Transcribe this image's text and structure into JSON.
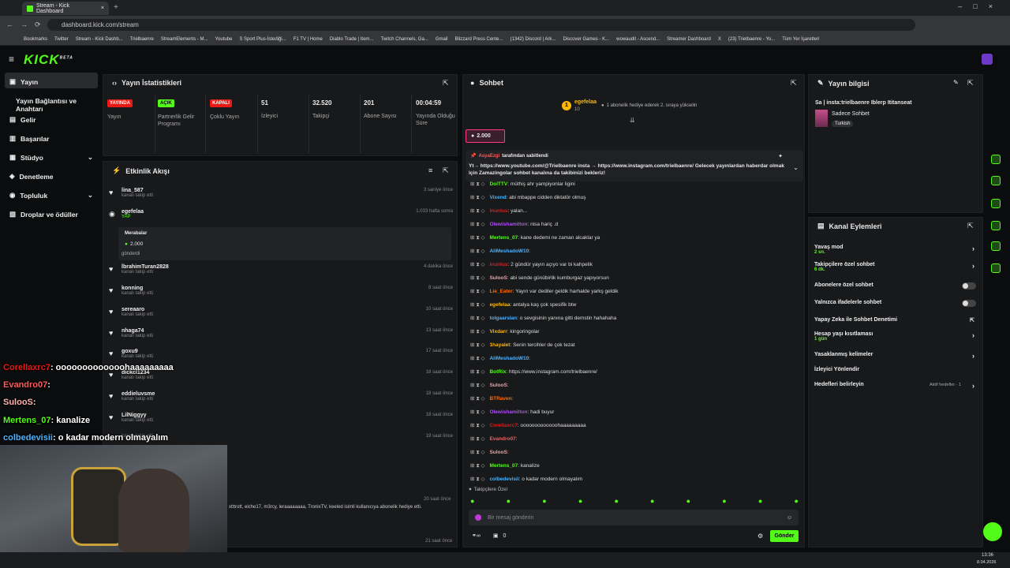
{
  "browser": {
    "tab_title": "Stream - Kick Dashboard",
    "url": "dashboard.kick.com/stream",
    "bookmarks": [
      "Bookmarks",
      "Twitter",
      "Stream - Kick Dashb...",
      "Trielbaenre",
      "StreamElements - M...",
      "Youtube",
      "S Sport Plus-İstediği...",
      "F1 TV | Home",
      "Diablo Trade | Item...",
      "Twitch Channels, Ga...",
      "Gmail",
      "Blizzard Press Cente...",
      "(1342) Discord | Ark...",
      "Discover Games - K...",
      "wowaudit - Ascend...",
      "Streamer Dashboard",
      "X",
      "(23) Trielbaenre - Yo...",
      "Tüm Yer İşaretleri"
    ]
  },
  "logo": "KICK",
  "logo_tag": "BETA",
  "sidebar": {
    "items": [
      {
        "label": "Yayın"
      },
      {
        "label": "Yayın Bağlantısı ve Anahtarı"
      },
      {
        "label": "Gelir"
      },
      {
        "label": "Başarılar"
      },
      {
        "label": "Stüdyo"
      },
      {
        "label": "Denetleme"
      },
      {
        "label": "Topluluk"
      },
      {
        "label": "Droplar ve ödüller"
      }
    ]
  },
  "stats": {
    "title": "Yayın İstatistikleri",
    "items": [
      {
        "badge": "YAYINDA",
        "label": "Yayın",
        "color": "#e91916"
      },
      {
        "badge": "AÇIK",
        "label": "Partnerlik Gelir Programı",
        "color": "#53fc18"
      },
      {
        "badge": "KAPALI",
        "label": "Çoklu Yayın",
        "color": "#e91916"
      },
      {
        "value": "51",
        "label": "İzleyici"
      },
      {
        "value": "32.520",
        "label": "Takipçi"
      },
      {
        "value": "201",
        "label": "Abone Sayısı"
      },
      {
        "value": "00:04:59",
        "label": "Yayında Olduğu Süre"
      }
    ]
  },
  "feed": {
    "title": "Etkinlik Akışı",
    "items": [
      {
        "name": "lina_587",
        "sub": "kanalı takip etti",
        "time": "3 saniye önce"
      },
      {
        "name": "egefelaa",
        "sub": "YAP",
        "time": "1.033 hafta sonra"
      },
      {
        "name": "İbrahimTuran2828",
        "sub": "kanalı takip etti",
        "time": "4 dakika önce"
      },
      {
        "name": "konning",
        "sub": "kanalı takip etti",
        "time": "8 saat önce"
      },
      {
        "name": "sereaaro",
        "sub": "kanalı takip etti",
        "time": "10 saat önce"
      },
      {
        "name": "nhaga74",
        "sub": "kanalı takip etti",
        "time": "13 saat önce"
      },
      {
        "name": "goxu9",
        "sub": "kanalı takip etti",
        "time": "17 saat önce"
      },
      {
        "name": "dickcl1234",
        "sub": "kanalı takip etti",
        "time": "18 saat önce"
      },
      {
        "name": "eddieluvsme",
        "sub": "kanalı takip etti",
        "time": "18 saat önce"
      },
      {
        "name": "LilNiggyy",
        "sub": "kanalı takip etti",
        "time": "18 saat önce"
      },
      {
        "name": "",
        "sub": "kanalı takip etti",
        "time": "19 saat önce"
      }
    ],
    "gift": {
      "label": "Merabalar",
      "amount": "2.000",
      "note": "gönderdi"
    },
    "subs_line": "xtttrott, eiche17, m3rcy, leraaaaaaaa, TronixTV, keeled isimli kullanıcıya abonelik hediye etti.",
    "subs_time": "20 saat önce",
    "last_time": "21 saat önce"
  },
  "overlay": [
    {
      "name": "Corellaxrc7",
      "msg": ": ooooooooooooohaaaaaaaaa",
      "color": "#e91916"
    },
    {
      "name": "Evandro07",
      "msg": ":",
      "color": "#ff5a5a"
    },
    {
      "name": "SulooS",
      "msg": ":",
      "color": "#ffb0b0"
    },
    {
      "name": "Mertens_07",
      "msg": ": kanalize",
      "color": "#53fc18"
    },
    {
      "name": "colbedevisii",
      "msg": ": o kadar modern olmayalım",
      "color": "#49b3ff"
    }
  ],
  "chat": {
    "title": "Sohbet",
    "top_user": "egefelaa",
    "top_rank": "1",
    "top_count": "10",
    "gift_note": "1 abonelik hediye ederek 2. sıraya yükselin",
    "kicks": "2.000",
    "pinned_by": "AsyaEzgi",
    "pinned_label": "tarafından sabitlendi",
    "pinned_text": "Yt→ https://www.youtube.com/@Trielbaenre insta → https://www.instagram.com/trielbaenre/ Gelecek yayınlardan haberdar olmak için Zamazingolar sohbet kanalına da takibinizi bekleriz!",
    "lines": [
      {
        "u": "DolTTV",
        "c": "#53fc18",
        "m": ": müthiş ahr yampiyonlar ligini"
      },
      {
        "u": "Vixend",
        "c": "#49b3ff",
        "m": ": abi mbappe cidden diktatör olmuş"
      },
      {
        "u": "inunlus",
        "c": "#e91916",
        "m": ": yalan..."
      },
      {
        "u": "Olewishamilton",
        "c": "#b14cff",
        "m": ": nisa hariç .d"
      },
      {
        "u": "Mertens_07",
        "c": "#53fc18",
        "m": ": kane dedemi ne zaman alcaklar ya"
      },
      {
        "u": "AliMeshadoW10",
        "c": "#49b3ff",
        "m": ":"
      },
      {
        "u": "inunlus",
        "c": "#e91916",
        "m": ": 2 gündür yayın açıyo var bi kahpelik"
      },
      {
        "u": "SulooS",
        "c": "#ff9b9b",
        "m": ": abi sende günübirlik kumburgaz yapıyorsun"
      },
      {
        "u": "Lie_Eater",
        "c": "#ff6a00",
        "m": ": Yayın var dediler geldik harhalde yarkş geldik"
      },
      {
        "u": "egefelaa",
        "c": "#ffb800",
        "m": ": antalya kaş çok spesifik btw"
      },
      {
        "u": "tolgaarslan",
        "c": "#49b3ff",
        "m": ": o sevgisinin yanına gitti demstin hahahaha"
      },
      {
        "u": "Vixdarr",
        "c": "#ffb800",
        "m": ": kingoringolar"
      },
      {
        "u": "1hayalet",
        "c": "#ffb800",
        "m": ": Senin tercihler de çok tezat"
      },
      {
        "u": "AliMeshadoW10",
        "c": "#49b3ff",
        "m": ":"
      },
      {
        "u": "BotRix",
        "c": "#53fc18",
        "m": ": https://www.instagram.com/trielbaenre/"
      },
      {
        "u": "SulooS",
        "c": "#ff9b9b",
        "m": ":"
      },
      {
        "u": "BTRaven",
        "c": "#ff6a00",
        "m": ":"
      },
      {
        "u": "Olewishamilton",
        "c": "#b14cff",
        "m": ": hadi buyur"
      },
      {
        "u": "Corellaxrc7",
        "c": "#e91916",
        "m": ": ooooooooooooohaaaaaaaaa"
      },
      {
        "u": "Evandro07",
        "c": "#ff5a5a",
        "m": ":"
      },
      {
        "u": "SulooS",
        "c": "#ff9b9b",
        "m": ":"
      },
      {
        "u": "Mertens_07",
        "c": "#53fc18",
        "m": ": kanalize"
      },
      {
        "u": "colbedevisii",
        "c": "#49b3ff",
        "m": ": o kadar modern olmayalım"
      }
    ],
    "followers_only": "Takipçilere Özel",
    "placeholder": "Bir mesaj gönderin",
    "send": "Gönder",
    "footer_count": "0"
  },
  "info": {
    "title": "Yayın bilgisi",
    "stream_title": "Sa | insta:trielbaenre Iblerp Ititanseat",
    "category": "Sadece Sohbet",
    "tag": "Turkish"
  },
  "actions": {
    "title": "Kanal Eylemleri",
    "items": [
      {
        "label": "Yavaş mod",
        "sub": "2 sn."
      },
      {
        "label": "Takipçilere özel sohbet",
        "sub": "6 dk."
      },
      {
        "label": "Abonelere özel sohbet",
        "sub": ""
      },
      {
        "label": "Yalnızca ifadelerle sohbet",
        "sub": ""
      },
      {
        "label": "Yapay Zeka ile Sohbet Denetimi",
        "sub": ""
      },
      {
        "label": "Hesap yaşı kısıtlaması",
        "sub": "1 gün"
      },
      {
        "label": "Yasaklanmış kelimeler",
        "sub": ""
      },
      {
        "label": "İzleyici Yönlendir",
        "sub": ""
      },
      {
        "label": "Hedefleri belirleyin",
        "sub": ""
      }
    ],
    "goal_status": "Aktif hedefler · 1"
  },
  "clock": {
    "time": "13:36",
    "date": "8.04.2026"
  }
}
